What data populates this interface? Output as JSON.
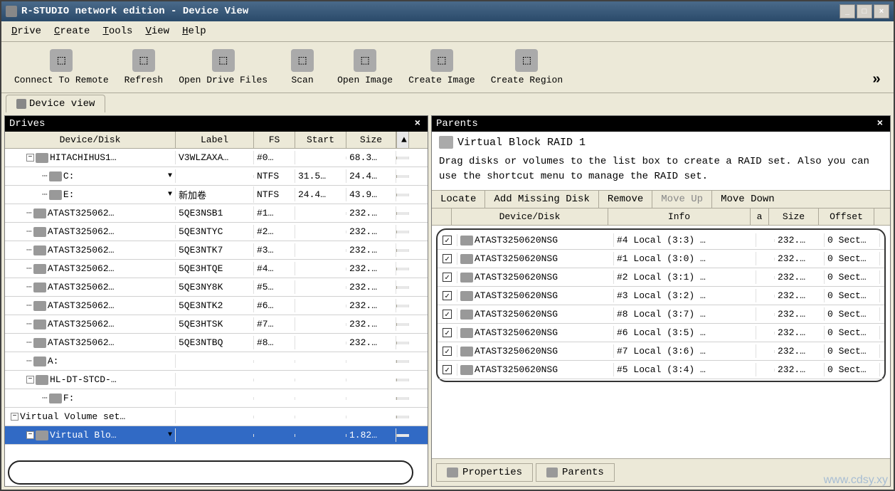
{
  "window": {
    "title": "R-STUDIO network edition - Device View"
  },
  "menus": [
    "Drive",
    "Create",
    "Tools",
    "View",
    "Help"
  ],
  "toolbar": [
    {
      "name": "connect-remote",
      "label": "Connect To Remote"
    },
    {
      "name": "refresh",
      "label": "Refresh"
    },
    {
      "name": "open-drive-files",
      "label": "Open Drive Files"
    },
    {
      "name": "scan",
      "label": "Scan"
    },
    {
      "name": "open-image",
      "label": "Open Image"
    },
    {
      "name": "create-image",
      "label": "Create Image"
    },
    {
      "name": "create-region",
      "label": "Create Region"
    }
  ],
  "tabs": {
    "device_view": "Device view"
  },
  "drives": {
    "title": "Drives",
    "columns": [
      "Device/Disk",
      "Label",
      "FS",
      "Start",
      "Size"
    ],
    "rows": [
      {
        "indent": 1,
        "exp": "-",
        "icon": true,
        "device": "HITACHIHUS1…",
        "label": "V3WLZAXA…",
        "fs": "#0…",
        "start": "",
        "size": "68.3…",
        "dd": false
      },
      {
        "indent": 2,
        "exp": "",
        "icon": true,
        "device": "C:",
        "label": "",
        "fs": "NTFS",
        "start": "31.5…",
        "size": "24.4…",
        "dd": true
      },
      {
        "indent": 2,
        "exp": "",
        "icon": true,
        "device": "E:",
        "label": "新加卷",
        "fs": "NTFS",
        "start": "24.4…",
        "size": "43.9…",
        "dd": true
      },
      {
        "indent": 1,
        "exp": "",
        "icon": true,
        "device": "ATAST325062…",
        "label": "5QE3NSB1",
        "fs": "#1…",
        "start": "",
        "size": "232.…",
        "dd": false
      },
      {
        "indent": 1,
        "exp": "",
        "icon": true,
        "device": "ATAST325062…",
        "label": "5QE3NTYC",
        "fs": "#2…",
        "start": "",
        "size": "232.…",
        "dd": false
      },
      {
        "indent": 1,
        "exp": "",
        "icon": true,
        "device": "ATAST325062…",
        "label": "5QE3NTK7",
        "fs": "#3…",
        "start": "",
        "size": "232.…",
        "dd": false
      },
      {
        "indent": 1,
        "exp": "",
        "icon": true,
        "device": "ATAST325062…",
        "label": "5QE3HTQE",
        "fs": "#4…",
        "start": "",
        "size": "232.…",
        "dd": false
      },
      {
        "indent": 1,
        "exp": "",
        "icon": true,
        "device": "ATAST325062…",
        "label": "5QE3NY8K",
        "fs": "#5…",
        "start": "",
        "size": "232.…",
        "dd": false
      },
      {
        "indent": 1,
        "exp": "",
        "icon": true,
        "device": "ATAST325062…",
        "label": "5QE3NTK2",
        "fs": "#6…",
        "start": "",
        "size": "232.…",
        "dd": false
      },
      {
        "indent": 1,
        "exp": "",
        "icon": true,
        "device": "ATAST325062…",
        "label": "5QE3HTSK",
        "fs": "#7…",
        "start": "",
        "size": "232.…",
        "dd": false
      },
      {
        "indent": 1,
        "exp": "",
        "icon": true,
        "device": "ATAST325062…",
        "label": "5QE3NTBQ",
        "fs": "#8…",
        "start": "",
        "size": "232.…",
        "dd": false
      },
      {
        "indent": 1,
        "exp": "",
        "icon": true,
        "device": "A:",
        "label": "",
        "fs": "",
        "start": "",
        "size": "",
        "dd": false
      },
      {
        "indent": 1,
        "exp": "-",
        "icon": true,
        "device": "HL-DT-STCD-…",
        "label": "",
        "fs": "",
        "start": "",
        "size": "",
        "dd": false
      },
      {
        "indent": 2,
        "exp": "",
        "icon": true,
        "device": "F:",
        "label": "",
        "fs": "",
        "start": "",
        "size": "",
        "dd": false
      },
      {
        "indent": 0,
        "exp": "-",
        "icon": false,
        "device": "Virtual Volume set…",
        "label": "",
        "fs": "",
        "start": "",
        "size": "",
        "dd": false
      },
      {
        "indent": 1,
        "exp": "-",
        "icon": true,
        "device": "Virtual Blo…",
        "label": "",
        "fs": "",
        "start": "",
        "size": "1.82…",
        "dd": true,
        "selected": true
      }
    ]
  },
  "parents": {
    "title": "Parents",
    "raid_title": "Virtual Block RAID 1",
    "hint": "Drag disks or volumes to the list box to create a RAID set. Also you can use the shortcut menu to manage the RAID set.",
    "buttons": {
      "locate": "Locate",
      "add": "Add Missing Disk",
      "remove": "Remove",
      "up": "Move Up",
      "down": "Move Down"
    },
    "columns": [
      "",
      "Device/Disk",
      "Info",
      "a",
      "Size",
      "Offset"
    ],
    "rows": [
      {
        "checked": true,
        "device": "ATAST3250620NSG",
        "info": "#4 Local (3:3) …",
        "a": "",
        "size": "232.…",
        "offset": "0 Sect…"
      },
      {
        "checked": true,
        "device": "ATAST3250620NSG",
        "info": "#1 Local (3:0) …",
        "a": "",
        "size": "232.…",
        "offset": "0 Sect…"
      },
      {
        "checked": true,
        "device": "ATAST3250620NSG",
        "info": "#2 Local (3:1) …",
        "a": "",
        "size": "232.…",
        "offset": "0 Sect…"
      },
      {
        "checked": true,
        "device": "ATAST3250620NSG",
        "info": "#3 Local (3:2) …",
        "a": "",
        "size": "232.…",
        "offset": "0 Sect…"
      },
      {
        "checked": true,
        "device": "ATAST3250620NSG",
        "info": "#8 Local (3:7) …",
        "a": "",
        "size": "232.…",
        "offset": "0 Sect…"
      },
      {
        "checked": true,
        "device": "ATAST3250620NSG",
        "info": "#6 Local (3:5) …",
        "a": "",
        "size": "232.…",
        "offset": "0 Sect…"
      },
      {
        "checked": true,
        "device": "ATAST3250620NSG",
        "info": "#7 Local (3:6) …",
        "a": "",
        "size": "232.…",
        "offset": "0 Sect…"
      },
      {
        "checked": true,
        "device": "ATAST3250620NSG",
        "info": "#5 Local (3:4) …",
        "a": "",
        "size": "232.…",
        "offset": "0 Sect…"
      }
    ],
    "bottom": {
      "properties": "Properties",
      "parents": "Parents"
    }
  },
  "watermark": "www.cdsy.xy"
}
